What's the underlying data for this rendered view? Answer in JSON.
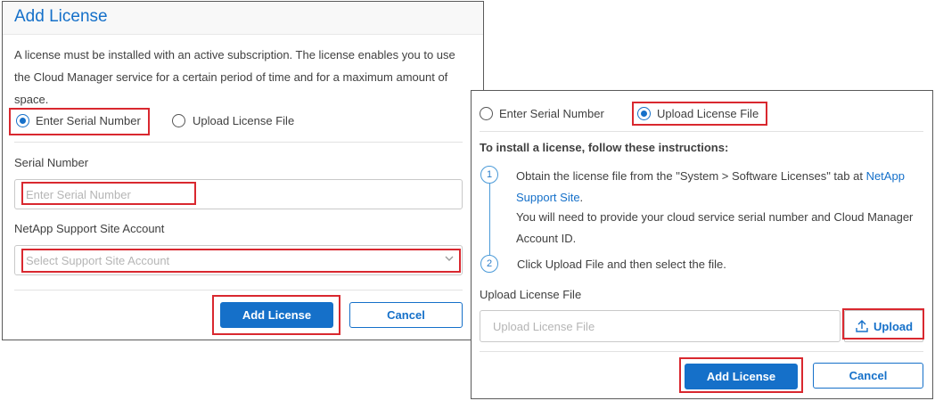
{
  "left_panel": {
    "title": "Add License",
    "description": "A license must be installed with an active subscription. The license enables you to use the Cloud Manager service for a certain period of time and for a maximum amount of space.",
    "radio_serial_label": "Enter Serial Number",
    "radio_upload_label": "Upload License File",
    "selected_option": "Enter Serial Number",
    "serial_label": "Serial Number",
    "serial_placeholder": "Enter Serial Number",
    "account_label": "NetApp Support Site Account",
    "account_placeholder": "Select Support Site Account",
    "add_button": "Add License",
    "cancel_button": "Cancel"
  },
  "right_panel": {
    "radio_serial_label": "Enter Serial Number",
    "radio_upload_label": "Upload License File",
    "selected_option": "Upload License File",
    "instructions_title": "To install a license, follow these instructions:",
    "steps": [
      {
        "number": "1",
        "text_before_link": "Obtain the license file from the \"System > Software Licenses\" tab at ",
        "link_text": "NetApp Support Site",
        "text_after_link": ".",
        "extra": "You will need to provide your cloud service serial number and Cloud Manager Account ID."
      },
      {
        "number": "2",
        "text": "Click Upload File and then select the file."
      }
    ],
    "upload_label": "Upload License File",
    "upload_placeholder": "Upload License File",
    "upload_button": "Upload",
    "add_button": "Add License",
    "cancel_button": "Cancel"
  },
  "colors": {
    "accent": "#1570c9",
    "highlight": "#d9282f"
  },
  "icons": [
    "radio-selected",
    "radio-unselected",
    "chevron-down-icon",
    "upload-icon"
  ]
}
